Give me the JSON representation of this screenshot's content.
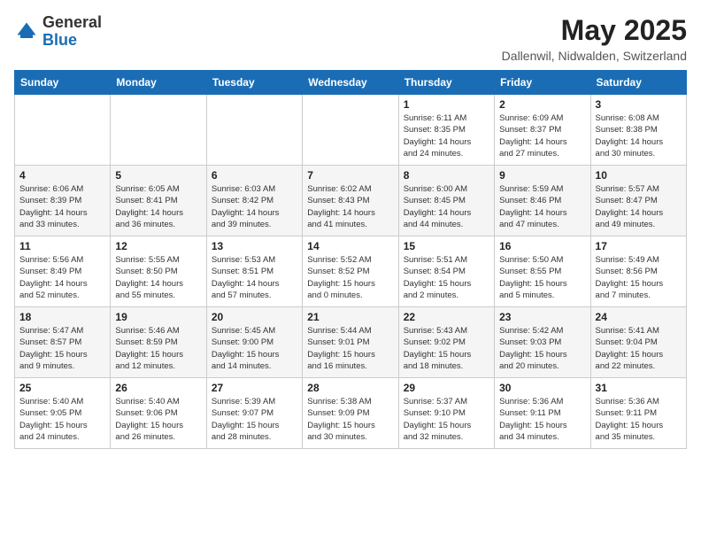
{
  "logo": {
    "general": "General",
    "blue": "Blue"
  },
  "header": {
    "title": "May 2025",
    "subtitle": "Dallenwil, Nidwalden, Switzerland"
  },
  "weekdays": [
    "Sunday",
    "Monday",
    "Tuesday",
    "Wednesday",
    "Thursday",
    "Friday",
    "Saturday"
  ],
  "weeks": [
    [
      {
        "day": "",
        "info": ""
      },
      {
        "day": "",
        "info": ""
      },
      {
        "day": "",
        "info": ""
      },
      {
        "day": "",
        "info": ""
      },
      {
        "day": "1",
        "info": "Sunrise: 6:11 AM\nSunset: 8:35 PM\nDaylight: 14 hours\nand 24 minutes."
      },
      {
        "day": "2",
        "info": "Sunrise: 6:09 AM\nSunset: 8:37 PM\nDaylight: 14 hours\nand 27 minutes."
      },
      {
        "day": "3",
        "info": "Sunrise: 6:08 AM\nSunset: 8:38 PM\nDaylight: 14 hours\nand 30 minutes."
      }
    ],
    [
      {
        "day": "4",
        "info": "Sunrise: 6:06 AM\nSunset: 8:39 PM\nDaylight: 14 hours\nand 33 minutes."
      },
      {
        "day": "5",
        "info": "Sunrise: 6:05 AM\nSunset: 8:41 PM\nDaylight: 14 hours\nand 36 minutes."
      },
      {
        "day": "6",
        "info": "Sunrise: 6:03 AM\nSunset: 8:42 PM\nDaylight: 14 hours\nand 39 minutes."
      },
      {
        "day": "7",
        "info": "Sunrise: 6:02 AM\nSunset: 8:43 PM\nDaylight: 14 hours\nand 41 minutes."
      },
      {
        "day": "8",
        "info": "Sunrise: 6:00 AM\nSunset: 8:45 PM\nDaylight: 14 hours\nand 44 minutes."
      },
      {
        "day": "9",
        "info": "Sunrise: 5:59 AM\nSunset: 8:46 PM\nDaylight: 14 hours\nand 47 minutes."
      },
      {
        "day": "10",
        "info": "Sunrise: 5:57 AM\nSunset: 8:47 PM\nDaylight: 14 hours\nand 49 minutes."
      }
    ],
    [
      {
        "day": "11",
        "info": "Sunrise: 5:56 AM\nSunset: 8:49 PM\nDaylight: 14 hours\nand 52 minutes."
      },
      {
        "day": "12",
        "info": "Sunrise: 5:55 AM\nSunset: 8:50 PM\nDaylight: 14 hours\nand 55 minutes."
      },
      {
        "day": "13",
        "info": "Sunrise: 5:53 AM\nSunset: 8:51 PM\nDaylight: 14 hours\nand 57 minutes."
      },
      {
        "day": "14",
        "info": "Sunrise: 5:52 AM\nSunset: 8:52 PM\nDaylight: 15 hours\nand 0 minutes."
      },
      {
        "day": "15",
        "info": "Sunrise: 5:51 AM\nSunset: 8:54 PM\nDaylight: 15 hours\nand 2 minutes."
      },
      {
        "day": "16",
        "info": "Sunrise: 5:50 AM\nSunset: 8:55 PM\nDaylight: 15 hours\nand 5 minutes."
      },
      {
        "day": "17",
        "info": "Sunrise: 5:49 AM\nSunset: 8:56 PM\nDaylight: 15 hours\nand 7 minutes."
      }
    ],
    [
      {
        "day": "18",
        "info": "Sunrise: 5:47 AM\nSunset: 8:57 PM\nDaylight: 15 hours\nand 9 minutes."
      },
      {
        "day": "19",
        "info": "Sunrise: 5:46 AM\nSunset: 8:59 PM\nDaylight: 15 hours\nand 12 minutes."
      },
      {
        "day": "20",
        "info": "Sunrise: 5:45 AM\nSunset: 9:00 PM\nDaylight: 15 hours\nand 14 minutes."
      },
      {
        "day": "21",
        "info": "Sunrise: 5:44 AM\nSunset: 9:01 PM\nDaylight: 15 hours\nand 16 minutes."
      },
      {
        "day": "22",
        "info": "Sunrise: 5:43 AM\nSunset: 9:02 PM\nDaylight: 15 hours\nand 18 minutes."
      },
      {
        "day": "23",
        "info": "Sunrise: 5:42 AM\nSunset: 9:03 PM\nDaylight: 15 hours\nand 20 minutes."
      },
      {
        "day": "24",
        "info": "Sunrise: 5:41 AM\nSunset: 9:04 PM\nDaylight: 15 hours\nand 22 minutes."
      }
    ],
    [
      {
        "day": "25",
        "info": "Sunrise: 5:40 AM\nSunset: 9:05 PM\nDaylight: 15 hours\nand 24 minutes."
      },
      {
        "day": "26",
        "info": "Sunrise: 5:40 AM\nSunset: 9:06 PM\nDaylight: 15 hours\nand 26 minutes."
      },
      {
        "day": "27",
        "info": "Sunrise: 5:39 AM\nSunset: 9:07 PM\nDaylight: 15 hours\nand 28 minutes."
      },
      {
        "day": "28",
        "info": "Sunrise: 5:38 AM\nSunset: 9:09 PM\nDaylight: 15 hours\nand 30 minutes."
      },
      {
        "day": "29",
        "info": "Sunrise: 5:37 AM\nSunset: 9:10 PM\nDaylight: 15 hours\nand 32 minutes."
      },
      {
        "day": "30",
        "info": "Sunrise: 5:36 AM\nSunset: 9:11 PM\nDaylight: 15 hours\nand 34 minutes."
      },
      {
        "day": "31",
        "info": "Sunrise: 5:36 AM\nSunset: 9:11 PM\nDaylight: 15 hours\nand 35 minutes."
      }
    ]
  ]
}
